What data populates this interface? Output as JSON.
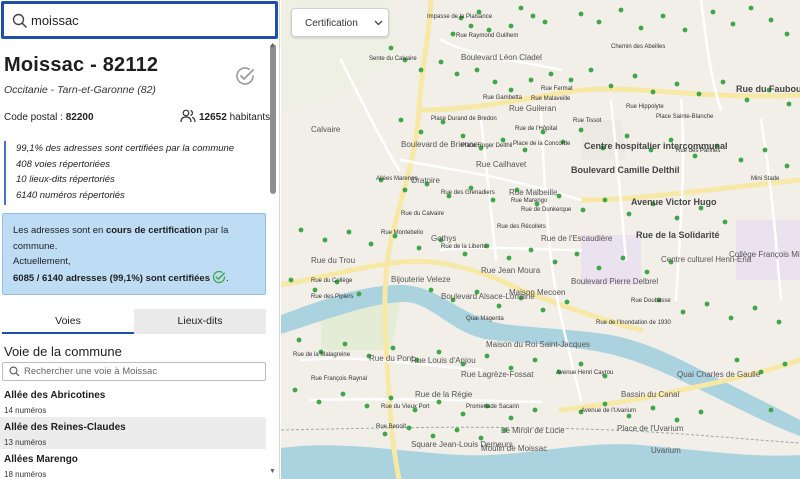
{
  "search": {
    "value": "moissac"
  },
  "commune": {
    "title": "Moissac - 82112",
    "region": "Occitanie - Tarn-et-Garonne (82)",
    "postal_label": "Code postal : ",
    "postal_code": "82200",
    "population_value": "12652",
    "population_label": " habitants",
    "stats": [
      "99,1% des adresses sont certifiées par la commune",
      "408 voies répertoriées",
      "10 lieux-dits répertoriés",
      "6140 numéros répertoriés"
    ]
  },
  "info": {
    "line1_a": "Les adresses sont en ",
    "line1_b": "cours de certification",
    "line1_c": " par la commune.",
    "line2": "Actuellement,",
    "line3": "6085 / 6140 adresses (99,1%) sont certifiées"
  },
  "tabs": [
    {
      "label": "Voies",
      "active": true
    },
    {
      "label": "Lieux-dits",
      "active": false
    }
  ],
  "voies": {
    "title": "Voie de la commune",
    "search_placeholder": "Rechercher une voie à Moissac",
    "items": [
      {
        "name": "Allée des Abricotines",
        "count": "14 numéros"
      },
      {
        "name": "Allée des Reines-Claudes",
        "count": "13 numéros"
      },
      {
        "name": "Allées Marengo",
        "count": "18 numéros"
      }
    ]
  },
  "map": {
    "filter_label": "Certification",
    "labels": {
      "impasse_plaisance": "Impasse de la Plaisance",
      "boulevard_leon_cladel": "Boulevard Léon Cladel",
      "rue_raymond_guilhem": "Rue Raymond Guilhem",
      "chemin_abeilles": "Chemin des Abeilles",
      "sente_calvaire": "Sente du Calvaire",
      "calvaire": "Calvaire",
      "rue_fermat": "Rue Fermat",
      "rue_gambetta": "Rue Gambetta",
      "rue_guileran": "Rue Guileran",
      "place_durand": "Place Durand de Bredon",
      "rue_hopital": "Rue de l'Hôpital",
      "rue_tissot": "Rue Tissot",
      "rue_malaveille": "Rue Malaveille",
      "rue_faub_sainte_blanche": "Rue du Faubourg Sainte-Blanche",
      "rue_hippolyte": "Rue Hippolyte",
      "place_sainte_blanche": "Place Sainte-Blanche",
      "boulevard_brienne": "Boulevard de Brienne",
      "place_roger_delthil": "Place Roger Delthil",
      "place_concorde": "Place de la Concorde",
      "centre_hospitalier": "Centre hospitalier intercommunal",
      "rue_cailhavet": "Rue Cailhavet",
      "rue_des_pannes": "Rue des Pannes",
      "allees_marengo": "Allées Marengo",
      "rue_grenadiers": "Rue des Grenadiers",
      "boulevard_camille": "Boulevard Camille Delthil",
      "rue_malbeille": "Rue Malbeille",
      "rue_marengo": "Rue Marengo",
      "rue_dunkerque": "Rue de Dunkerque",
      "mini_stade": "Mini Stade",
      "avenue_victor_hugo": "Avenue Victor Hugo",
      "rue_calvaire": "Rue du Calvaire",
      "rue_recollets": "Rue des Récollets",
      "rue_escaudiere": "Rue de l'Escaudière",
      "rue_solidarite": "Rue de la Solidarité",
      "centre_culturel": "Centre culturel Henri-Ena",
      "college": "Collège François Mitterrand",
      "rue_trou": "Rue du Trou",
      "rue_liberte": "Rue de la Liberté",
      "rue_jean_moura": "Rue Jean Moura",
      "rue_montebello": "Rue Montebello",
      "boulevard_pierre_delbrel": "Boulevard Pierre Delbrel",
      "rue_doubasse": "Rue Doubasse",
      "boulevard_alsace": "Boulevard Alsace-Lorraine",
      "maison_mecoen": "Maison Mecoen",
      "bijouterie": "Bijouterie Veleze",
      "rue_college": "Rue du Collège",
      "rue_pipiers": "Rue des Pipiers",
      "quai_magenta": "Quai Magenta",
      "rue_inondation": "Rue de l'Inondation de 1930",
      "rue_malagreine": "Rue de la Malagreine",
      "rue_pont": "Rue du Pont",
      "rue_louis_anjou": "Rue Louis d'Anjou",
      "maison_saint_jacques": "Maison du Roi Saint-Jacques",
      "rue_francois_raynal": "Rue François Raynal",
      "rue_lagreze": "Rue Lagrèze-Fossat",
      "avenue_henri": "Avenue Henri Cayrou",
      "quai_charles": "Quai Charles de Gaulle",
      "rue_regie": "Rue de la Régie",
      "rue_vieux_port": "Rue du Vieux Port",
      "promenade_sacarin": "Promenade Sacarin",
      "bassin_canal": "Bassin du Canal",
      "place_uvarium": "Place de l'Uvarium",
      "avenue_uvarium": "Avenue de l'Uvarium",
      "square_jean_louis": "Square Jean-Louis Demeurs",
      "moulin_moissac": "Moulin de Moissac",
      "miroir_lucie": "Le Miroir de Lucie",
      "uvarium": "Uvarium",
      "oratoire": "Oratoire",
      "gothys": "Gothys",
      "rue_benoit": "Rue Benoît"
    }
  },
  "colors": {
    "accent": "#1f4fa8",
    "dot": "#3fa64a",
    "info_bg": "#bfdcf5",
    "river": "#aad3df",
    "road_major": "#f7e8a6"
  },
  "icons": [
    "search-icon",
    "check-circle-icon",
    "people-icon",
    "chevron-down-icon"
  ]
}
